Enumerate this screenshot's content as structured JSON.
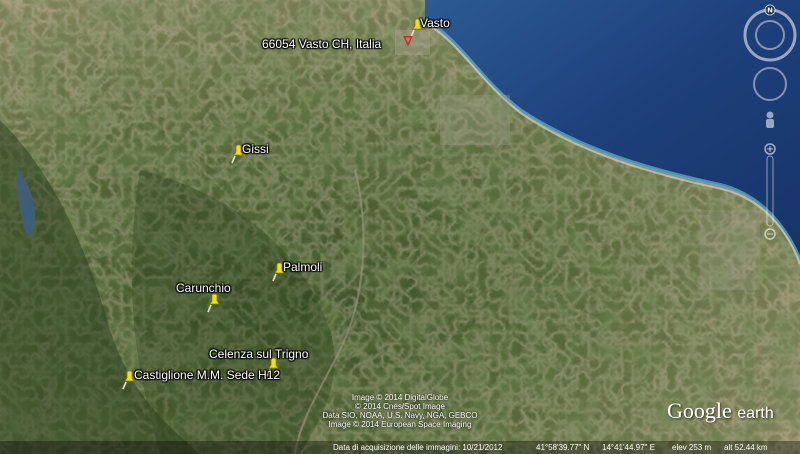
{
  "places": [
    {
      "id": "vasto",
      "name": "Vasto",
      "color": "#f2e20a"
    },
    {
      "id": "gissi",
      "name": "Gissi",
      "color": "#f2e20a"
    },
    {
      "id": "palmoli",
      "name": "Palmoli",
      "color": "#f2e20a"
    },
    {
      "id": "carunchio",
      "name": "Carunchio",
      "color": "#f2e20a"
    },
    {
      "id": "celenza",
      "name": "Celenza sul Trigno",
      "color": "#f2e20a"
    },
    {
      "id": "castiglione",
      "name": "Castiglione M.M. Sede H12",
      "color": "#f2e20a"
    }
  ],
  "search_result": {
    "address": "66054 Vasto CH, Italia",
    "marker_color": "#d8262b"
  },
  "credits": [
    "Image © 2014 DigitalGlobe",
    "© 2014 Cnes/Spot Image",
    "Data SIO, NOAA, U.S. Navy, NGA, GEBCO",
    "Image © 2014 European Space Imaging"
  ],
  "status": {
    "imagery_date": "Data di acquisizione delle immagini: 10/21/2012",
    "latitude": "41°58'39.77\" N",
    "longitude": "14°41'44.97\" E",
    "elevation": "elev  253 m",
    "eye_altitude": "alt  52.44 km"
  },
  "logo": {
    "google": "Google",
    "earth": "earth"
  },
  "compass": {
    "north_label": "N"
  },
  "colors": {
    "sea": "#1d3f7a",
    "coast": "#2f78a8",
    "land": "#5a6a3a",
    "forest": "#2f4420"
  }
}
